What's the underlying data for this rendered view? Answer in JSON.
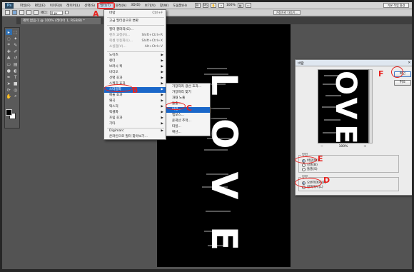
{
  "menubar": {
    "logo": "Ps",
    "items": [
      "파일(F)",
      "편집(E)",
      "이미지(I)",
      "레이어(L)",
      "선택(S)",
      "필터(T)",
      "분석(A)",
      "3D(D)",
      "보기(V)",
      "창(W)",
      "도움말(H)"
    ],
    "zoom": "100%",
    "workspace_button": "기본 작업 환경"
  },
  "optbar": {
    "feather_label": "페더:",
    "feather_value": "0 px",
    "refine_button": "가장자리 다듬기..."
  },
  "document_tab": "제목 없음-1 @ 100% (레이어 1, RGB/8) *",
  "filter_menu": {
    "items": [
      {
        "label": "바람",
        "shortcut": "Ctrl+F"
      },
      {
        "label": "고급 필터용으로 변환",
        "shortcut": ""
      },
      {
        "label": "필터 갤러리(G)...",
        "shortcut": ""
      },
      {
        "label": "렌즈 교정(R)...",
        "shortcut": "Shift+Ctrl+R"
      },
      {
        "label": "픽셀 유동화(L)...",
        "shortcut": "Shift+Ctrl+X"
      },
      {
        "label": "소실점(V)...",
        "shortcut": "Alt+Ctrl+V"
      },
      {
        "label": "노이즈",
        "shortcut": ""
      },
      {
        "label": "렌더",
        "shortcut": ""
      },
      {
        "label": "브러시 획",
        "shortcut": ""
      },
      {
        "label": "비디오",
        "shortcut": ""
      },
      {
        "label": "선명 효과",
        "shortcut": ""
      },
      {
        "label": "스케치 효과",
        "shortcut": ""
      },
      {
        "label": "스타일화",
        "shortcut": ""
      },
      {
        "label": "예술 효과",
        "shortcut": ""
      },
      {
        "label": "왜곡",
        "shortcut": ""
      },
      {
        "label": "텍스처",
        "shortcut": ""
      },
      {
        "label": "픽셀화",
        "shortcut": ""
      },
      {
        "label": "흐림 효과",
        "shortcut": ""
      },
      {
        "label": "기타",
        "shortcut": ""
      },
      {
        "label": "Digimarc",
        "shortcut": ""
      },
      {
        "label": "온라인으로 필터 찾아보기...",
        "shortcut": ""
      }
    ]
  },
  "submenu": {
    "items": [
      "가장자리 광선 효과...",
      "가장자리 찾기",
      "과대 노출",
      "돌출...",
      "바람...",
      "엠보스...",
      "윤곽선 추적...",
      "타일...",
      "확산..."
    ]
  },
  "canvas_text": [
    "L",
    "O",
    "V",
    "E"
  ],
  "dialog": {
    "title": "바람",
    "ok": "확인",
    "cancel": "취소",
    "zoom_minus": "−",
    "zoom_value": "100%",
    "zoom_plus": "+",
    "method_label": "방법",
    "method_options": [
      "바람(W)",
      "강풍(B)",
      "돌풍(S)"
    ],
    "direction_label": "방향",
    "direction_options": [
      "오른쪽에서(R)",
      "왼쪽에서(L)"
    ]
  },
  "annotations": {
    "a": "A",
    "b": "B",
    "c": "C",
    "d": "D",
    "e": "E",
    "f": "F"
  },
  "colors": {
    "accent": "#1a67c9",
    "annotation": "#e8221f"
  }
}
